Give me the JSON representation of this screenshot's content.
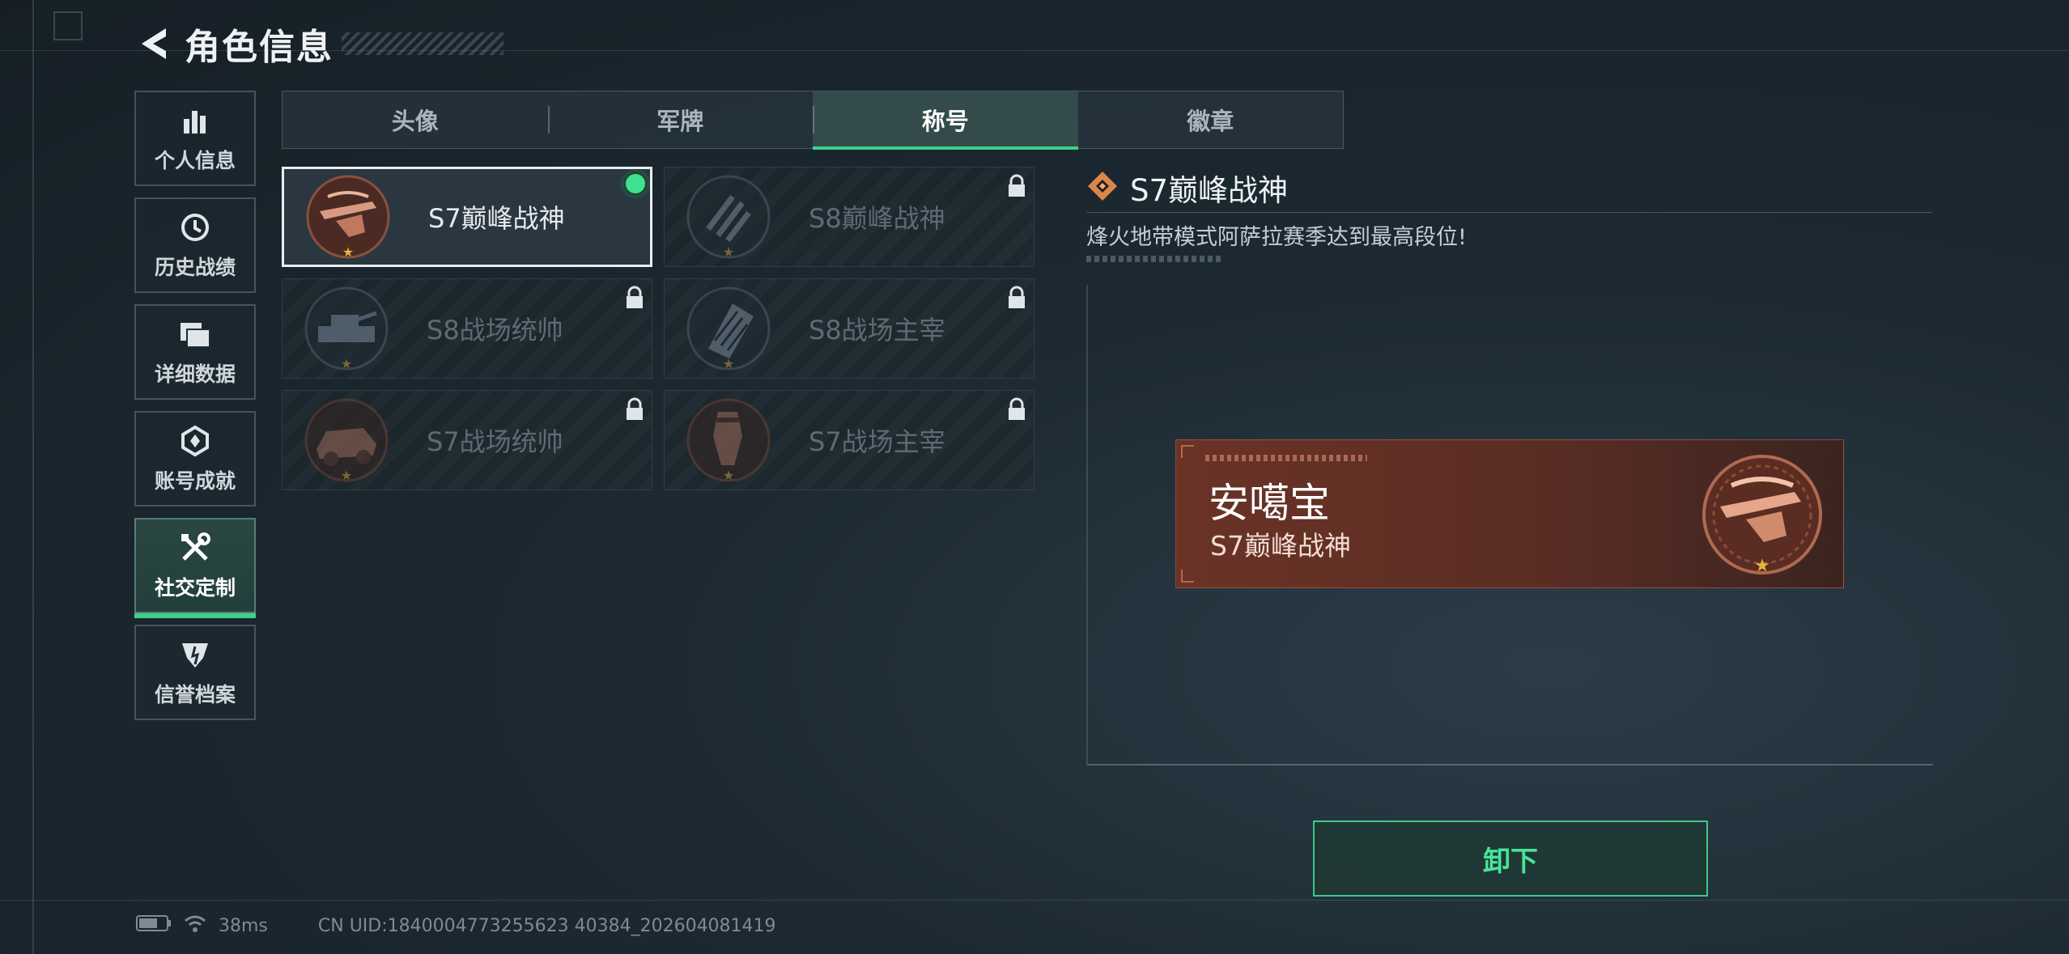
{
  "header": {
    "title": "角色信息"
  },
  "sidenav": {
    "items": [
      {
        "label": "个人信息",
        "icon": "bar-chart-icon"
      },
      {
        "label": "历史战绩",
        "icon": "history-clock-icon"
      },
      {
        "label": "详细数据",
        "icon": "folder-icon"
      },
      {
        "label": "账号成就",
        "icon": "achievement-icon"
      },
      {
        "label": "社交定制",
        "icon": "tools-icon",
        "active": true
      },
      {
        "label": "信誉档案",
        "icon": "shield-badge-icon"
      }
    ]
  },
  "tabs": [
    {
      "label": "头像"
    },
    {
      "label": "军牌"
    },
    {
      "label": "称号",
      "active": true
    },
    {
      "label": "徽章"
    }
  ],
  "titles": [
    {
      "name": "S7巅峰战神",
      "locked": false,
      "equipped": true,
      "emblem": "crossbow-emblem-icon"
    },
    {
      "name": "S8巅峰战神",
      "locked": true,
      "emblem": "stripes-emblem-icon"
    },
    {
      "name": "S8战场统帅",
      "locked": true,
      "emblem": "tank-emblem-icon"
    },
    {
      "name": "S8战场主宰",
      "locked": true,
      "emblem": "grid-emblem-icon"
    },
    {
      "name": "S7战场统帅",
      "locked": true,
      "emblem": "vehicle-emblem-icon"
    },
    {
      "name": "S7战场主宰",
      "locked": true,
      "emblem": "soldier-emblem-icon"
    }
  ],
  "detail": {
    "title": "S7巅峰战神",
    "description": "烽火地带模式阿萨拉赛季达到最高段位!"
  },
  "nameplate": {
    "player_name": "安噶宝",
    "title": "S7巅峰战神"
  },
  "actions": {
    "unequip_label": "卸下"
  },
  "status_bar": {
    "ping": "38ms",
    "uid": "CN UID:1840004773255623 40384_202604081419"
  },
  "colors": {
    "accent_green": "#3fd18a",
    "nameplate_bg": "#6a3326",
    "star_gold": "#e8b43a"
  }
}
